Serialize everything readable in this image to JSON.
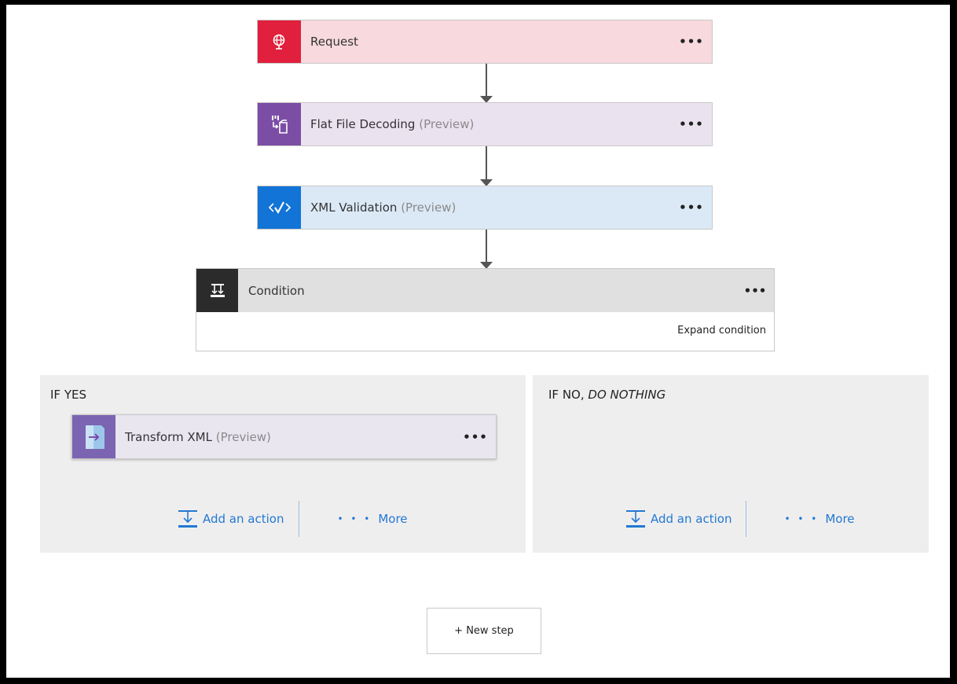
{
  "colors": {
    "request_icon": "#e0203c",
    "request_bg": "#f7d9de",
    "flatfile_icon": "#7b4da5",
    "flatfile_bg": "#ebe2ef",
    "xml_icon": "#1174d6",
    "xml_bg": "#dbe9f6",
    "condition_icon": "#2b2b2b",
    "condition_bg": "#e0e0e0",
    "transform_icon": "#7b64b1",
    "transform_bg": "#e9e6f0",
    "link": "#2278d4"
  },
  "steps": [
    {
      "title": "Request",
      "preview": "",
      "icon": "globe-pin-icon",
      "menu": "•••"
    },
    {
      "title": "Flat File Decoding",
      "preview": "(Preview)",
      "icon": "flat-file-icon",
      "menu": "•••"
    },
    {
      "title": "XML Validation",
      "preview": "(Preview)",
      "icon": "xml-check-icon",
      "menu": "•••"
    }
  ],
  "condition": {
    "title": "Condition",
    "icon": "condition-icon",
    "menu": "•••",
    "expand_label": "Expand condition"
  },
  "if_yes": {
    "title": "IF YES",
    "action": {
      "title": "Transform XML",
      "preview": "(Preview)",
      "icon": "transform-icon",
      "menu": "•••"
    },
    "add_action": "Add an action",
    "more": "More"
  },
  "if_no": {
    "title_prefix": "IF NO, ",
    "title_emph": "DO NOTHING",
    "add_action": "Add an action",
    "more": "More"
  },
  "new_step": "+ New step"
}
